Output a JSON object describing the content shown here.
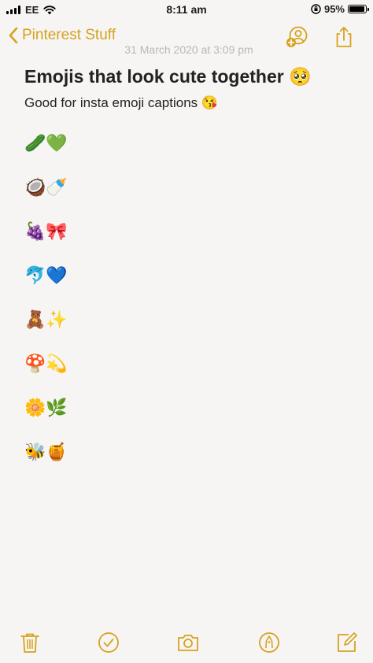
{
  "status_bar": {
    "carrier": "EE",
    "time": "8:11 am",
    "battery": "95%",
    "battery_level": 0.95
  },
  "nav": {
    "back_label": "Pinterest Stuff",
    "date": "31 March 2020 at 3:09 pm"
  },
  "note": {
    "title": "Emojis that look cute together 🥺",
    "subtitle": "Good for insta emoji captions 😘",
    "rows": [
      "🥒💚",
      "🥥🍼",
      "🍇🎀",
      "🐬💙",
      "🧸✨",
      "🍄💫",
      "🌼🌿",
      "🐝🍯"
    ]
  },
  "icons": {
    "back": "chevron-left-icon",
    "add_person": "add-person-icon",
    "share": "share-icon",
    "trash": "trash-icon",
    "checklist": "checklist-icon",
    "camera": "camera-icon",
    "markup": "markup-pen-icon",
    "compose": "compose-icon"
  },
  "colors": {
    "accent": "#d6a21e",
    "background": "#f6f5f3"
  }
}
